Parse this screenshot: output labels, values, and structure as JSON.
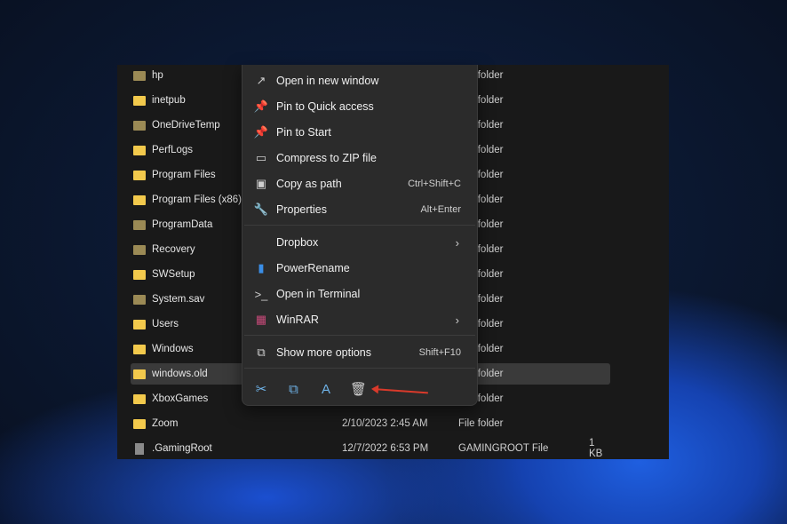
{
  "files": [
    {
      "name": "hp",
      "date": "",
      "type": "File folder",
      "size": "",
      "hidden": true
    },
    {
      "name": "inetpub",
      "date": "",
      "type": "File folder",
      "size": ""
    },
    {
      "name": "OneDriveTemp",
      "date": "",
      "type": "File folder",
      "size": "",
      "hidden": true
    },
    {
      "name": "PerfLogs",
      "date": "",
      "type": "File folder",
      "size": ""
    },
    {
      "name": "Program Files",
      "date": "",
      "type": "File folder",
      "size": ""
    },
    {
      "name": "Program Files (x86)",
      "date": "",
      "type": "File folder",
      "size": ""
    },
    {
      "name": "ProgramData",
      "date": "",
      "type": "File folder",
      "size": "",
      "hidden": true
    },
    {
      "name": "Recovery",
      "date": "",
      "type": "File folder",
      "size": "",
      "hidden": true
    },
    {
      "name": "SWSetup",
      "date": "",
      "type": "File folder",
      "size": ""
    },
    {
      "name": "System.sav",
      "date": "",
      "type": "File folder",
      "size": "",
      "hidden": true
    },
    {
      "name": "Users",
      "date": "",
      "type": "File folder",
      "size": ""
    },
    {
      "name": "Windows",
      "date": "",
      "type": "File folder",
      "size": ""
    },
    {
      "name": "windows.old",
      "date": "",
      "type": "File folder",
      "size": "",
      "selected": true
    },
    {
      "name": "XboxGames",
      "date": "",
      "type": "File folder",
      "size": ""
    },
    {
      "name": "Zoom",
      "date": "2/10/2023 2:45 AM",
      "type": "File folder",
      "size": ""
    },
    {
      "name": ".GamingRoot",
      "date": "12/7/2022 6:53 PM",
      "type": "GAMINGROOT File",
      "size": "1 KB",
      "file": true
    }
  ],
  "menu": {
    "items": [
      {
        "label": "Open in new window",
        "icon": "open-new-window-icon",
        "glyph": "↗",
        "shortcut": ""
      },
      {
        "label": "Pin to Quick access",
        "icon": "pin-icon",
        "glyph": "📌",
        "shortcut": ""
      },
      {
        "label": "Pin to Start",
        "icon": "pin-icon",
        "glyph": "📌",
        "shortcut": ""
      },
      {
        "label": "Compress to ZIP file",
        "icon": "zip-icon",
        "glyph": "▭",
        "shortcut": ""
      },
      {
        "label": "Copy as path",
        "icon": "copy-path-icon",
        "glyph": "▣",
        "shortcut": "Ctrl+Shift+C"
      },
      {
        "label": "Properties",
        "icon": "wrench-icon",
        "glyph": "🔧",
        "shortcut": "Alt+Enter"
      },
      {
        "label": "Dropbox",
        "icon": "",
        "glyph": "",
        "submenu": true
      },
      {
        "label": "PowerRename",
        "icon": "powerrename-icon",
        "glyph": "▮",
        "shortcut": ""
      },
      {
        "label": "Open in Terminal",
        "icon": "terminal-icon",
        "glyph": ">_",
        "shortcut": ""
      },
      {
        "label": "WinRAR",
        "icon": "winrar-icon",
        "glyph": "▦",
        "submenu": true
      },
      {
        "label": "Show more options",
        "icon": "show-more-icon",
        "glyph": "⧉",
        "shortcut": "Shift+F10"
      }
    ],
    "toolbar": [
      {
        "name": "cut",
        "icon": "scissors-icon",
        "glyph": "✂"
      },
      {
        "name": "copy",
        "icon": "copy-icon",
        "glyph": "⧉"
      },
      {
        "name": "rename",
        "icon": "rename-icon",
        "glyph": "A"
      },
      {
        "name": "delete",
        "icon": "trash-icon",
        "glyph": "🗑"
      }
    ]
  },
  "colors": {
    "accent": "#6fb3e8",
    "annotation": "#d93a2b"
  }
}
